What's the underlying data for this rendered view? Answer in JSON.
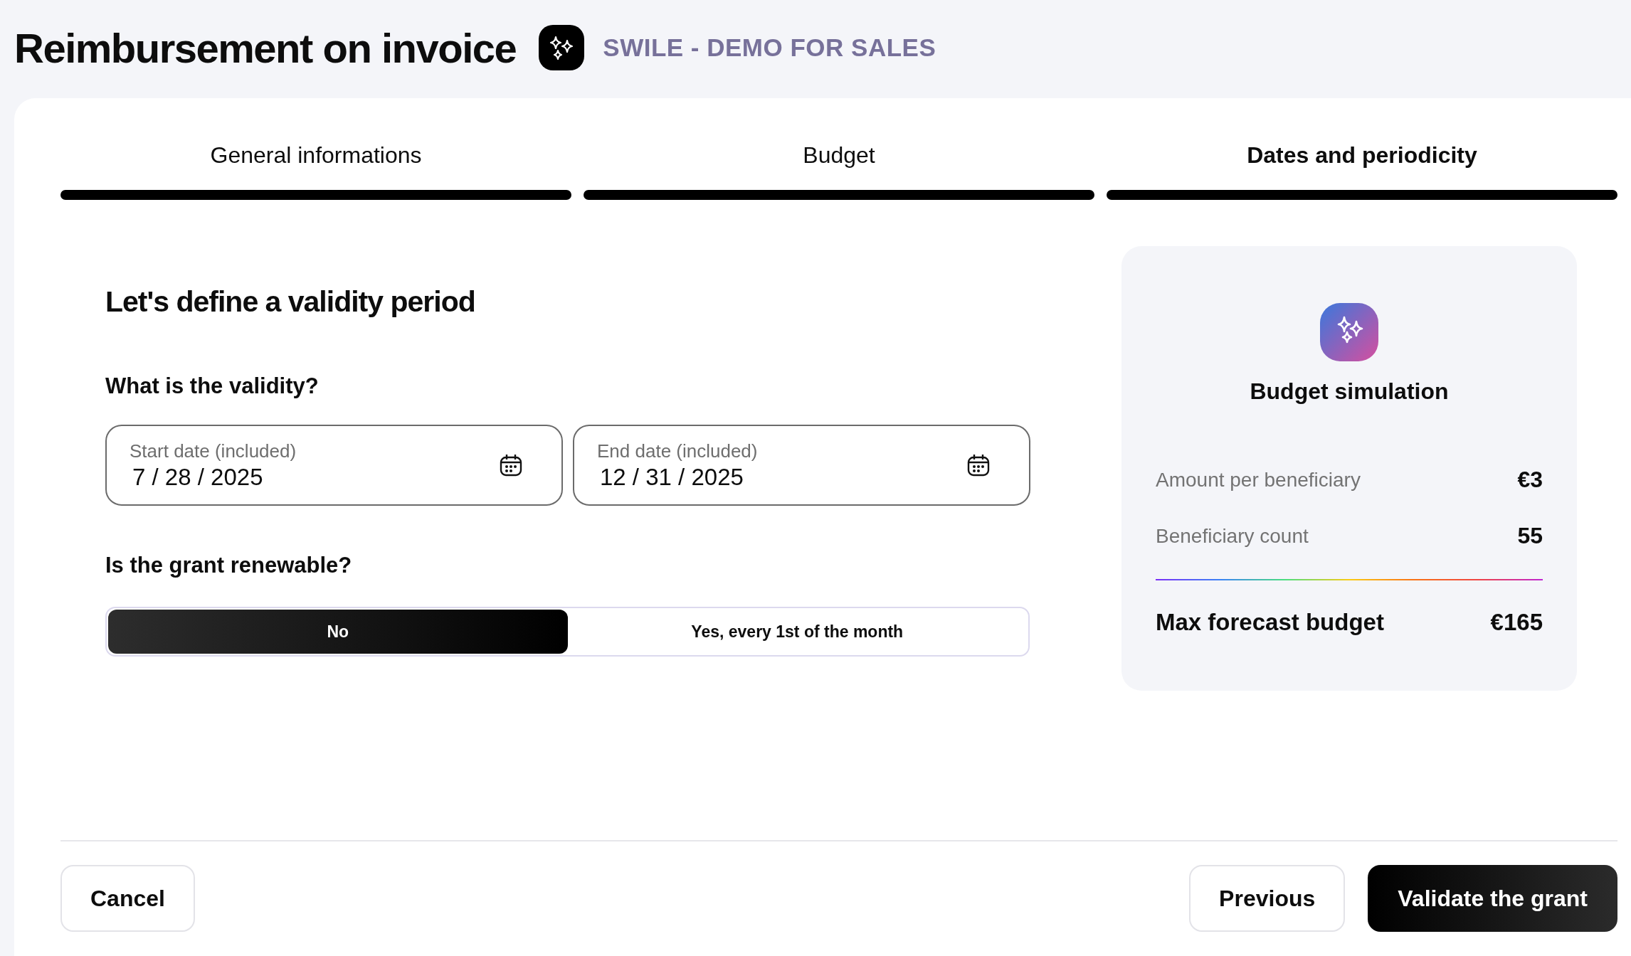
{
  "header": {
    "title": "Reimbursement on invoice",
    "subtitle": "SWILE - DEMO FOR SALES"
  },
  "steps": [
    {
      "label": "General informations",
      "selected": false,
      "completed": true
    },
    {
      "label": "Budget",
      "selected": false,
      "completed": true
    },
    {
      "label": "Dates and periodicity",
      "selected": true,
      "completed": true
    }
  ],
  "form": {
    "heading": "Let's define a validity period",
    "validity": {
      "question": "What is the validity?",
      "fields": [
        {
          "label": "Start date (included)",
          "value": "7 / 28 / 2025"
        },
        {
          "label": "End date (included)",
          "value": "12 / 31 / 2025"
        }
      ]
    },
    "renewable": {
      "question": "Is the grant renewable?",
      "options": [
        {
          "label": "No",
          "selected": true
        },
        {
          "label": "Yes, every 1st of the month",
          "selected": false
        }
      ]
    }
  },
  "simulation": {
    "title": "Budget simulation",
    "rows": [
      {
        "label": "Amount per beneficiary",
        "value": "€3"
      },
      {
        "label": "Beneficiary count",
        "value": "55"
      }
    ],
    "total": {
      "label": "Max forecast budget",
      "value": "€165"
    }
  },
  "footer": {
    "left_buttons": [
      {
        "label": "Cancel",
        "kind": "secondary"
      }
    ],
    "right_buttons": [
      {
        "label": "Previous",
        "kind": "secondary"
      },
      {
        "label": "Validate the grant",
        "kind": "primary"
      }
    ]
  }
}
